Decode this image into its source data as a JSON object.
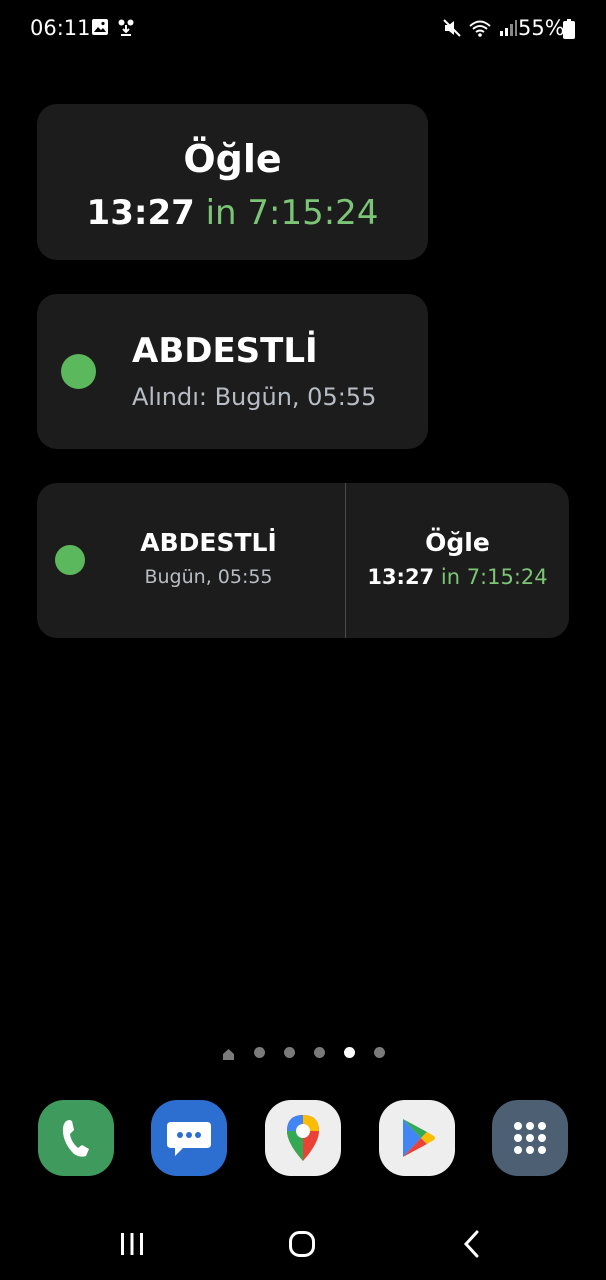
{
  "status_bar": {
    "time": "06:11",
    "battery": "55%",
    "left_icons": [
      "gallery-icon",
      "download-icon"
    ],
    "right_icons": [
      "mute-icon",
      "wifi-icon",
      "signal-icon",
      "battery-icon"
    ]
  },
  "widgets": {
    "prayer_small": {
      "prayer_name": "Öğle",
      "prayer_time": "13:27",
      "countdown": "in 7:15:24"
    },
    "abdest": {
      "title": "ABDESTLİ",
      "subtitle": "Alındı: Bugün, 05:55",
      "status_color": "#5cb85c"
    },
    "combined": {
      "abdest_title": "ABDESTLİ",
      "abdest_subtitle": "Bugün, 05:55",
      "prayer_name": "Öğle",
      "prayer_time": "13:27",
      "countdown": "in 7:15:24"
    }
  },
  "page_indicator": {
    "count": 6,
    "active_index": 4,
    "first_is_home": true
  },
  "dock": {
    "apps": [
      {
        "name": "phone-icon",
        "color": "#3f9a5d"
      },
      {
        "name": "messages-icon",
        "color": "#2d6fd1"
      },
      {
        "name": "maps-icon",
        "color": "#eeeeee"
      },
      {
        "name": "play-store-icon",
        "color": "#eeeeee"
      },
      {
        "name": "app-drawer-icon",
        "color": "#4d5f72"
      }
    ]
  },
  "nav_bar": {
    "buttons": [
      "recents-icon",
      "home-icon",
      "back-icon"
    ]
  },
  "colors": {
    "background": "#000000",
    "widget_bg": "#1c1c1c",
    "countdown_green": "#7cc576",
    "secondary_text": "#b8bdc4"
  }
}
